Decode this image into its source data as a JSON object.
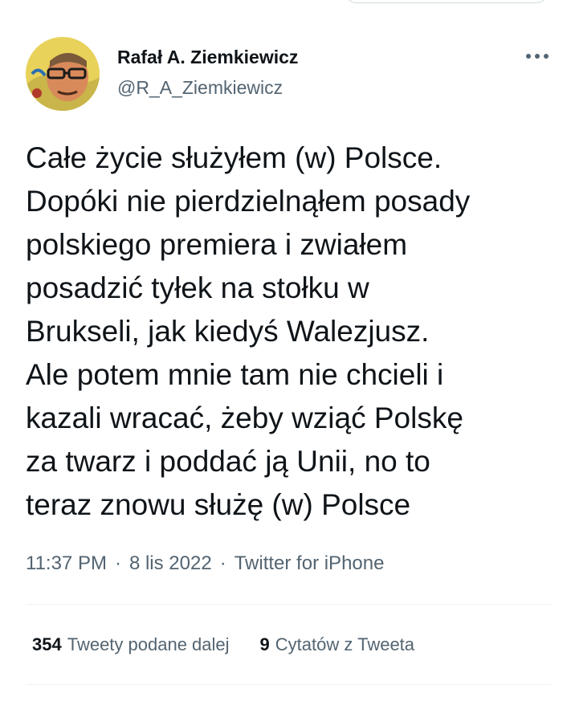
{
  "author": {
    "name": "Rafał A. Ziemkiewicz",
    "handle": "@R_A_Ziemkiewicz"
  },
  "tweet": {
    "text": "Całe życie służyłem (w) Polsce.\nDopóki nie pierdzielnąłem posady\npolskiego premiera i zwiałem\nposadzić tyłek na stołku w\nBrukseli, jak kiedyś Walezjusz.\nAle potem mnie tam nie chcieli i\nkazali wracać, żeby wziąć Polskę\nza twarz i poddać ją Unii, no to\nteraz znowu służę (w) Polsce"
  },
  "meta": {
    "time": "11:37 PM",
    "date": "8 lis 2022",
    "source": "Twitter for iPhone",
    "separator": "·"
  },
  "stats": {
    "retweets_count": "354",
    "retweets_label": "Tweety podane dalej",
    "quotes_count": "9",
    "quotes_label": "Cytatów z Tweeta"
  },
  "icons": {
    "more": "more-horizontal-icon"
  },
  "colors": {
    "text": "#0f1419",
    "secondary": "#536471",
    "divider": "#eff3f4"
  }
}
